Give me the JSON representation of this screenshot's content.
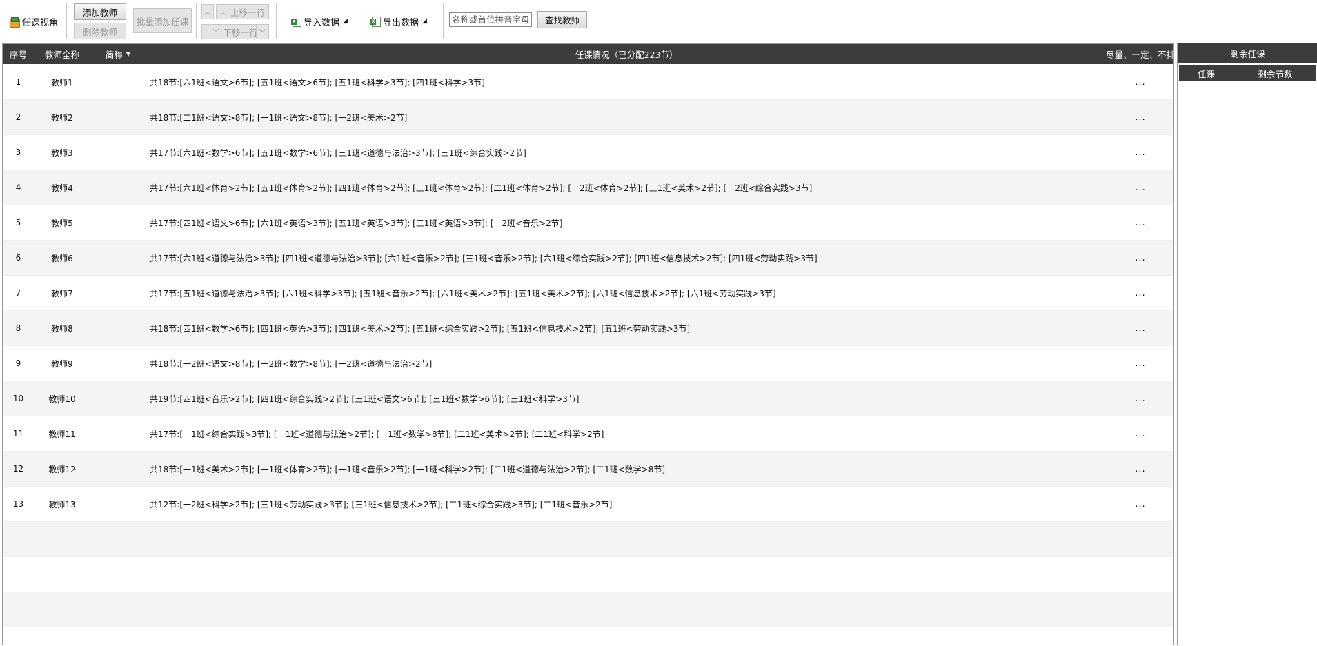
{
  "toolbar": {
    "view_label": "任课视角",
    "add_teacher": "添加教师",
    "delete_teacher": "删除教师",
    "batch_add": "批量添加任课",
    "move_up": "上移一行",
    "move_down": "下移一行",
    "import_data": "导入数据",
    "export_data": "导出数据",
    "search_placeholder": "名称或首位拼音字母",
    "find_teacher": "查找教师"
  },
  "grid": {
    "headers": {
      "index": "序号",
      "full_name": "教师全称",
      "short_name": "简称",
      "assignment": "任课情况（已分配223节）",
      "pref": "尽量、一定、不排"
    },
    "more_label": "...",
    "rows": [
      {
        "index": "1",
        "name": "教师1",
        "short": "",
        "assignment": "共18节:[六1班<语文>6节]; [五1班<语文>6节]; [五1班<科学>3节]; [四1班<科学>3节]"
      },
      {
        "index": "2",
        "name": "教师2",
        "short": "",
        "assignment": "共18节:[二1班<语文>8节]; [一1班<语文>8节]; [一2班<美术>2节]"
      },
      {
        "index": "3",
        "name": "教师3",
        "short": "",
        "assignment": "共17节:[六1班<数学>6节]; [五1班<数学>6节]; [三1班<道德与法治>3节]; [三1班<综合实践>2节]"
      },
      {
        "index": "4",
        "name": "教师4",
        "short": "",
        "assignment": "共17节:[六1班<体育>2节]; [五1班<体育>2节]; [四1班<体育>2节]; [三1班<体育>2节]; [二1班<体育>2节]; [一2班<体育>2节]; [三1班<美术>2节]; [一2班<综合实践>3节]"
      },
      {
        "index": "5",
        "name": "教师5",
        "short": "",
        "assignment": "共17节:[四1班<语文>6节]; [六1班<英语>3节]; [五1班<英语>3节]; [三1班<英语>3节]; [一2班<音乐>2节]"
      },
      {
        "index": "6",
        "name": "教师6",
        "short": "",
        "assignment": "共17节:[六1班<道德与法治>3节]; [四1班<道德与法治>3节]; [六1班<音乐>2节]; [三1班<音乐>2节]; [六1班<综合实践>2节]; [四1班<信息技术>2节]; [四1班<劳动实践>3节]"
      },
      {
        "index": "7",
        "name": "教师7",
        "short": "",
        "assignment": "共17节:[五1班<道德与法治>3节]; [六1班<科学>3节]; [五1班<音乐>2节]; [六1班<美术>2节]; [五1班<美术>2节]; [六1班<信息技术>2节]; [六1班<劳动实践>3节]"
      },
      {
        "index": "8",
        "name": "教师8",
        "short": "",
        "assignment": "共18节:[四1班<数学>6节]; [四1班<英语>3节]; [四1班<美术>2节]; [五1班<综合实践>2节]; [五1班<信息技术>2节]; [五1班<劳动实践>3节]"
      },
      {
        "index": "9",
        "name": "教师9",
        "short": "",
        "assignment": "共18节:[一2班<语文>8节]; [一2班<数学>8节]; [一2班<道德与法治>2节]"
      },
      {
        "index": "10",
        "name": "教师10",
        "short": "",
        "assignment": "共19节:[四1班<音乐>2节]; [四1班<综合实践>2节]; [三1班<语文>6节]; [三1班<数学>6节]; [三1班<科学>3节]"
      },
      {
        "index": "11",
        "name": "教师11",
        "short": "",
        "assignment": "共17节:[一1班<综合实践>3节]; [一1班<道德与法治>2节]; [一1班<数学>8节]; [二1班<美术>2节]; [二1班<科学>2节]"
      },
      {
        "index": "12",
        "name": "教师12",
        "short": "",
        "assignment": "共18节:[一1班<美术>2节]; [一1班<体育>2节]; [一1班<音乐>2节]; [一1班<科学>2节]; [二1班<道德与法治>2节]; [二1班<数学>8节]"
      },
      {
        "index": "13",
        "name": "教师13",
        "short": "",
        "assignment": "共12节:[一2班<科学>2节]; [三1班<劳动实践>3节]; [三1班<信息技术>2节]; [二1班<综合实践>3节]; [二1班<音乐>2节]"
      }
    ]
  },
  "right_panel": {
    "title": "剩余任课",
    "col_task": "任课",
    "col_remaining": "剩余节数"
  }
}
